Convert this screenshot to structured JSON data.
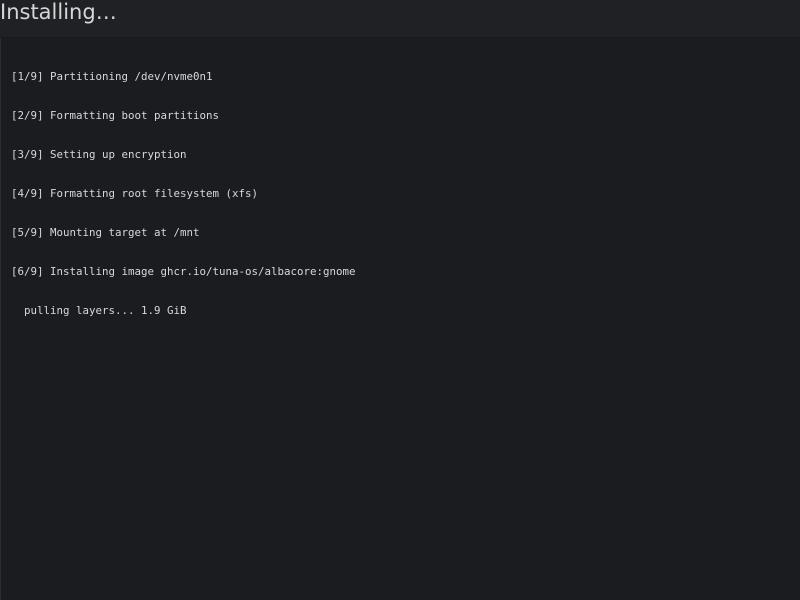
{
  "header": {
    "title": "Installing…"
  },
  "log": {
    "lines": [
      "[1/9] Partitioning /dev/nvme0n1",
      "[2/9] Formatting boot partitions",
      "[3/9] Setting up encryption",
      "[4/9] Formatting root filesystem (xfs)",
      "[5/9] Mounting target at /mnt",
      "[6/9] Installing image ghcr.io/tuna-os/albacore:gnome"
    ],
    "progress_line": "pulling layers... 1.9 GiB"
  },
  "colors": {
    "background": "#1b1c20",
    "header_background": "#202125",
    "text": "#d7d8da"
  }
}
